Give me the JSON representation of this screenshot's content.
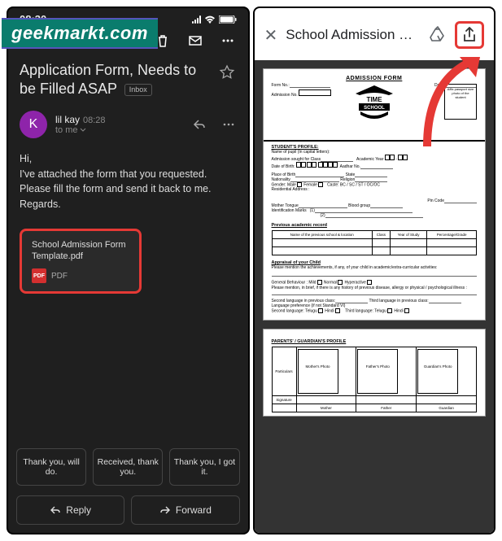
{
  "watermark": "geekmarkt.com",
  "left": {
    "status_time": "08:30",
    "subject": "Application Form, Needs to be Filled ASAP",
    "inbox_label": "Inbox",
    "sender": {
      "initial": "K",
      "name": "lil kay",
      "time": "08:28",
      "to": "to me"
    },
    "body": {
      "greeting": "Hi,",
      "line1": "I've attached the form that you requested. Please fill the form and send it back to me.",
      "signoff": "Regards."
    },
    "attachment": {
      "name": "School Admission Form Template.pdf",
      "type": "PDF",
      "badge": "PDF"
    },
    "smart_replies": [
      "Thank you, will do.",
      "Received, thank you.",
      "Thank you, I got it."
    ],
    "actions": {
      "reply": "Reply",
      "forward": "Forward"
    }
  },
  "right": {
    "title": "School Admission Fo...",
    "form": {
      "heading": "ADMISSION FORM",
      "logo_top": "TIME",
      "logo_bottom": "SCHOOL",
      "photo_hint": "Affix passport size photo of the student",
      "top_labels": {
        "form_no": "Form No.:",
        "date": "Date:",
        "admission_no": "Admission No."
      },
      "profile_head": "STUDENT'S PROFILE:",
      "labels": {
        "name": "Name of pupil (In capital letters):",
        "class": "Admission sought for Class",
        "year": "Academic Year",
        "dob": "Date of Birth:",
        "aadhar": "Aadhar No.",
        "pob": "Place of Birth",
        "state": "State",
        "nat": "Nationality",
        "rel": "Religion",
        "gender": "Gender:",
        "male": "Male",
        "female": "Female",
        "caste": "Caste:",
        "bc": "BC / SC / ST / OC/OC",
        "addr": "Residential Address :",
        "pin": "Pin Code",
        "mt": "Mother Tongue",
        "bg": "Blood group",
        "marks": "Identification Marks",
        "m1": "(1)",
        "m2": "(2)"
      },
      "prev_head": "Previous academic record",
      "prev_cols": [
        "Name of the previous school & location",
        "Class",
        "Year of Study",
        "Percentage/Grade"
      ],
      "appraisal_head": "Appraisal of your Child",
      "appraisal_text": "Please mention the achievements, if any, of your child in academic/extra-curricular activities:",
      "behav": "General Behaviour :   Mild",
      "b2": "Normal",
      "b3": "Hyperactive",
      "behav2": "Please mention, in brief, if there is any history of previous disease, allergy or physical / psychological illness :",
      "lang1": "Second language in previous class:",
      "lang2": "Third language in previous class:",
      "pref": "Language preference (if not Standard VI)",
      "sl": "Second language:",
      "tl": "Third language:",
      "telugu": "Telugu",
      "hindi": "Hindi",
      "parents_head": "PARENTS' / GUARDIAN'S PROFILE",
      "particulars": "Particulars",
      "mother_photo": "Mother's Photo",
      "father_photo": "Father's Photo",
      "guardian_photo": "Guardian's Photo",
      "signature": "Signature",
      "mother": "Mother",
      "father": "Father",
      "guardian": "Guardian"
    }
  }
}
